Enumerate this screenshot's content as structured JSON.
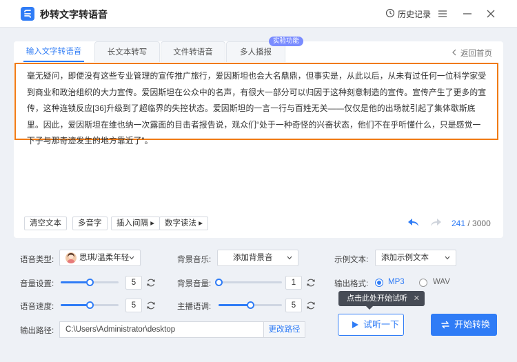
{
  "app": {
    "title": "秒转文字转语音",
    "history_label": "历史记录"
  },
  "tabs": [
    {
      "label": "输入文字转语音",
      "active": true
    },
    {
      "label": "长文本转写",
      "active": false
    },
    {
      "label": "文件转语音",
      "active": false
    },
    {
      "label": "多人播报",
      "active": false
    }
  ],
  "experimental_badge": "实验功能",
  "back_label": "返回首页",
  "editor": {
    "text": "毫无疑问，即便没有这些专业管理的宣传推广旅行，爱因斯坦也会大名鼎鼎，但事实是，从此以后，从未有过任何一位科学家受到商业和政治组织的大力宣传。爱因斯坦在公众中的名声，有很大一部分可以归因于这种刻意制造的宣传。宣传产生了更多的宣传，这种连锁反应[36]升级到了超临界的失控状态。爱因斯坦的一言一行与百姓无关——仅仅是他的出场就引起了集体歇斯底里。因此，爱因斯坦在维也纳一次露面的目击者报告说，观众们“处于一种奇怪的兴奋状态，他们不在乎听懂什么，只是感觉一下子与那奇迹发生的地方靠近了”。",
    "tools": [
      "清空文本",
      "多音字",
      "插入间隔 ▸",
      "数字读法 ▸"
    ],
    "count_current": "241",
    "count_separator": " / ",
    "count_max": "3000"
  },
  "settings": {
    "voice_type_label": "语音类型:",
    "voice_value": "思琪/温柔年轻",
    "bg_music_label": "背景音乐:",
    "bg_music_value": "添加背景音",
    "sample_label": "示例文本:",
    "sample_value": "添加示例文本",
    "volume_label": "音量设置:",
    "volume_value": "5",
    "volume_level": 0.5,
    "bg_volume_label": "背景音量:",
    "bg_volume_value": "1",
    "bg_volume_level": 0.0,
    "format_label": "输出格式:",
    "format_mp3": "MP3",
    "format_wav": "WAV",
    "format_selected": "MP3",
    "speed_label": "语音速度:",
    "speed_value": "5",
    "speed_level": 0.5,
    "pitch_label": "主播语调:",
    "pitch_value": "5",
    "pitch_level": 0.5,
    "output_path_label": "输出路径:",
    "output_path_value": "C:\\Users\\Administrator\\desktop",
    "change_path_label": "更改路径"
  },
  "tooltip": {
    "text": "点击此处开始试听",
    "close": "✕"
  },
  "buttons": {
    "listen": "试听一下",
    "start": "开始转换"
  },
  "colors": {
    "accent": "#2f7cf6",
    "highlight_border": "#f07a14"
  }
}
